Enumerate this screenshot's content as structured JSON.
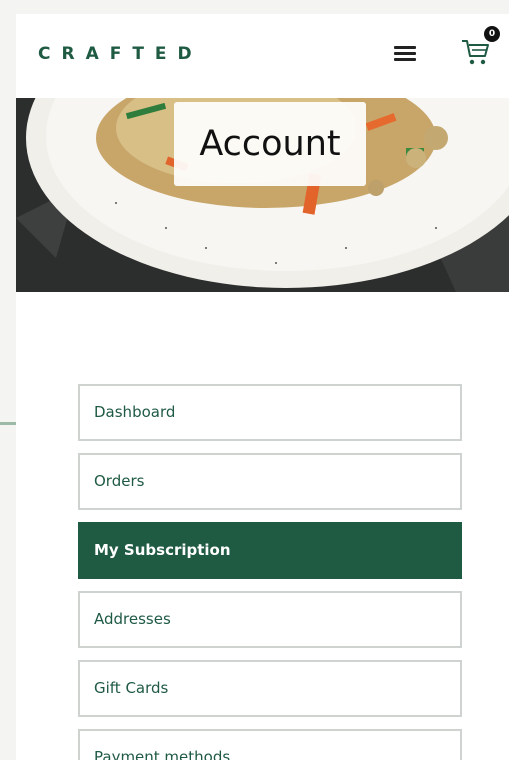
{
  "header": {
    "logo": "CRAFTED",
    "menu_icon": "hamburger-menu-icon",
    "cart_icon": "shopping-cart-icon",
    "cart_count": "0"
  },
  "hero": {
    "title": "Account"
  },
  "nav": {
    "items": [
      {
        "label": "Dashboard",
        "active": false
      },
      {
        "label": "Orders",
        "active": false
      },
      {
        "label": "My Subscription",
        "active": true
      },
      {
        "label": "Addresses",
        "active": false
      },
      {
        "label": "Gift Cards",
        "active": false
      },
      {
        "label": "Payment methods",
        "active": false
      }
    ]
  },
  "colors": {
    "brand": "#1f5a43",
    "active_bg": "#1f5a43",
    "border": "#cfd3d0"
  }
}
